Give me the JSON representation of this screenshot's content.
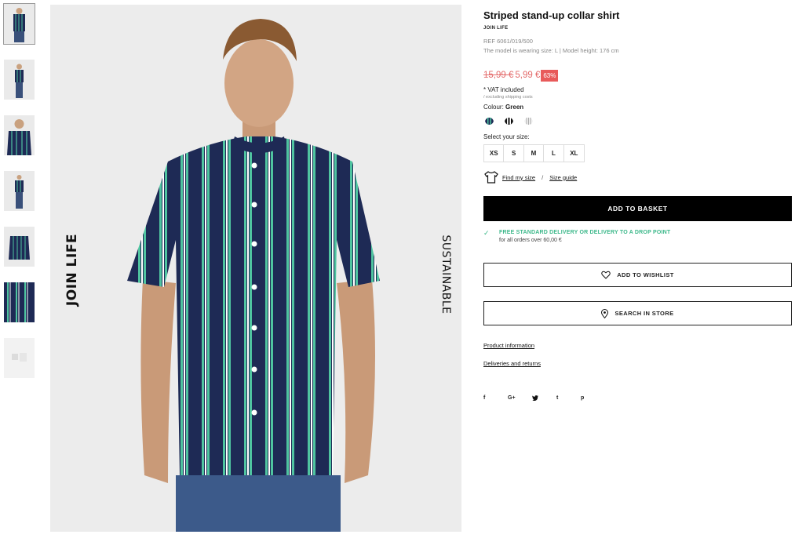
{
  "product": {
    "title": "Striped stand-up collar shirt",
    "brand": "JOIN LIFE",
    "ref": "REF 6061/019/500",
    "model_info": "The model is wearing size: L | Model height: 176 cm",
    "old_price": "15,99 €",
    "new_price": "5,99 €",
    "discount": "63%",
    "vat": "* VAT included",
    "shipping_note": "/ excluding shipping costs",
    "colour_label": "Colour:",
    "colour_value": "Green",
    "colours": [
      "navy-green-stripe",
      "black-white-stripe",
      "grey-stripe"
    ],
    "size_label": "Select your size:",
    "sizes": [
      "XS",
      "S",
      "M",
      "L",
      "XL"
    ],
    "find_my_size": "Find my size",
    "size_guide": "Size guide",
    "separator": "/"
  },
  "actions": {
    "add_to_basket": "ADD TO BASKET",
    "add_to_wishlist": "ADD TO WISHLIST",
    "search_in_store": "SEARCH IN STORE"
  },
  "delivery": {
    "title": "FREE STANDARD DELIVERY OR DELIVERY TO A DROP POINT",
    "subtitle": "for all orders over 60,00 €"
  },
  "links": {
    "product_information": "Product information",
    "deliveries_and_returns": "Deliveries and returns"
  },
  "social": [
    "f",
    "G+",
    "t-bird",
    "t",
    "p"
  ],
  "image_text": {
    "left": "JOIN LIFE",
    "right": "SUSTAINABLE"
  },
  "colors": {
    "accent_green": "#3cb88a",
    "discount_red": "#e85a5a",
    "price_red": "#e36a6a",
    "shirt_navy": "#1e2a55"
  }
}
